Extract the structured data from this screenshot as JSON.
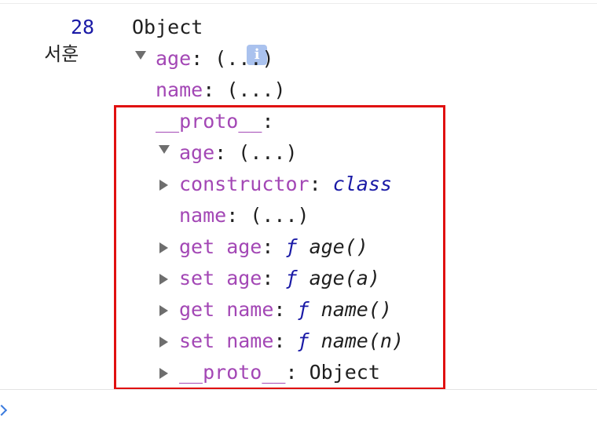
{
  "log": {
    "prefix": "서훈",
    "number": "28",
    "object_label": "Object",
    "info_icon": "i"
  },
  "properties": [
    {
      "key": "age",
      "sep": ": ",
      "value": "(...)"
    },
    {
      "key": "name",
      "sep": ": ",
      "value": "(...)"
    }
  ],
  "proto": {
    "key": "__proto__",
    "sep": ":",
    "items": [
      {
        "key": "age",
        "sep": ": ",
        "value": "(...)",
        "expandable": false
      },
      {
        "key": "constructor",
        "sep": ": ",
        "value": "class",
        "expandable": true
      },
      {
        "key": "name",
        "sep": ": ",
        "value": "(...)",
        "expandable": false
      },
      {
        "key": "get age",
        "sep": ": ",
        "fn": "ƒ",
        "value": " age()",
        "expandable": true
      },
      {
        "key": "set age",
        "sep": ": ",
        "fn": "ƒ",
        "value": " age(a)",
        "expandable": true
      },
      {
        "key": "get name",
        "sep": ": ",
        "fn": "ƒ",
        "value": " name()",
        "expandable": true
      },
      {
        "key": "set name",
        "sep": ": ",
        "fn": "ƒ",
        "value": " name(n)",
        "expandable": true
      },
      {
        "key": "__proto__",
        "sep": ": ",
        "value": "Object",
        "expandable": true
      }
    ]
  },
  "colors": {
    "property_key": "#a347b5",
    "number": "#1a1aa6",
    "highlight_border": "#e01010",
    "info_badge": "#aac2ee"
  },
  "icons": {
    "expand": "triangle-down-icon",
    "collapsed": "triangle-right-icon",
    "prompt": "chevron-right-icon"
  }
}
